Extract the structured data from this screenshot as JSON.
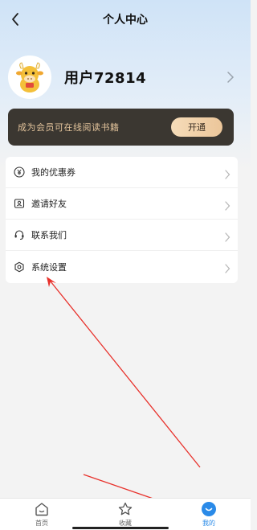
{
  "header": {
    "title": "个人中心"
  },
  "profile": {
    "username": "用户72814"
  },
  "vip": {
    "text": "成为会员可在线阅读书籍",
    "button": "开通"
  },
  "menu": {
    "items": [
      {
        "label": "我的优惠券",
        "icon": "coupon-icon"
      },
      {
        "label": "邀请好友",
        "icon": "invite-icon"
      },
      {
        "label": "联系我们",
        "icon": "headset-icon"
      },
      {
        "label": "系统设置",
        "icon": "settings-icon"
      }
    ]
  },
  "tabbar": {
    "items": [
      {
        "label": "首页",
        "icon": "home-icon",
        "active": false
      },
      {
        "label": "收藏",
        "icon": "star-icon",
        "active": false
      },
      {
        "label": "我的",
        "icon": "profile-icon",
        "active": true
      }
    ]
  },
  "colors": {
    "accent": "#2a8ae8",
    "vip_bg": "#3b3731",
    "vip_text": "#e2c39b",
    "annotation": "#e8302a"
  }
}
